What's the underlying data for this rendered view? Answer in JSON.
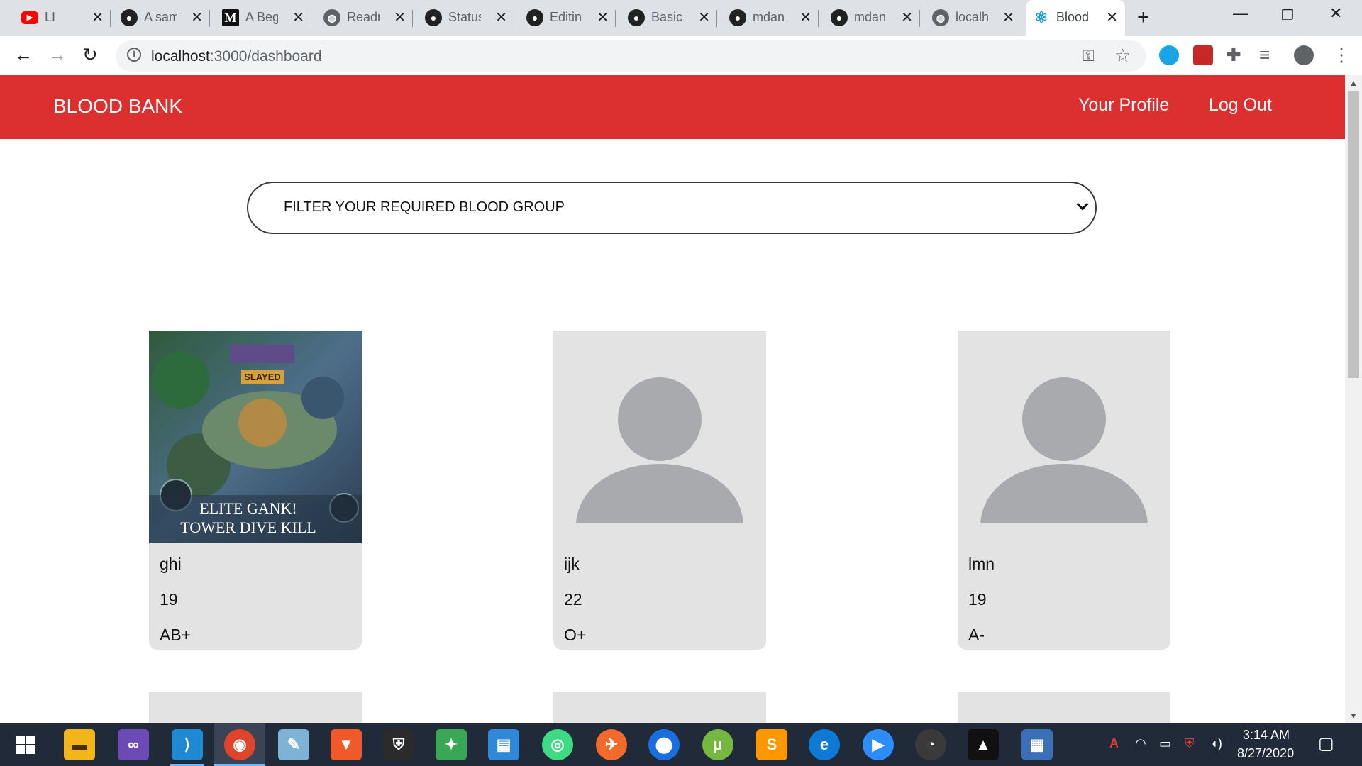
{
  "browser": {
    "tabs": [
      {
        "icon": "youtube-icon",
        "title": "LI"
      },
      {
        "icon": "github-icon",
        "title": "A sam"
      },
      {
        "icon": "medium-icon",
        "title": "A Beg"
      },
      {
        "icon": "globe-icon",
        "title": "Readr"
      },
      {
        "icon": "github-icon",
        "title": "Status"
      },
      {
        "icon": "github-icon",
        "title": "Editin"
      },
      {
        "icon": "github-icon",
        "title": "Basic"
      },
      {
        "icon": "github-icon",
        "title": "mdan"
      },
      {
        "icon": "github-icon",
        "title": "mdan"
      },
      {
        "icon": "globe-icon",
        "title": "localh"
      },
      {
        "icon": "react-icon",
        "title": "Blood",
        "active": true
      }
    ],
    "address": {
      "host": "localhost",
      "path": ":3000/dashboard"
    }
  },
  "app": {
    "brand": "BLOOD BANK",
    "nav": {
      "profile": "Your Profile",
      "logout": "Log Out"
    },
    "filter": {
      "selected": "FILTER YOUR REQUIRED BLOOD GROUP"
    },
    "donors": [
      {
        "name": "ghi",
        "age": "19",
        "blood_group": "AB+",
        "photo": "game-screenshot",
        "photo_caption_1": "ELITE GANK!",
        "photo_caption_2": "TOWER DIVE KILL",
        "photo_banner": "SLAYED"
      },
      {
        "name": "ijk",
        "age": "22",
        "blood_group": "O+",
        "photo": "default-avatar"
      },
      {
        "name": "lmn",
        "age": "19",
        "blood_group": "A-",
        "photo": "default-avatar"
      }
    ]
  },
  "taskbar": {
    "time": "3:14 AM",
    "date": "8/27/2020"
  },
  "colors": {
    "navbar": "#dc3030",
    "card": "#e3e3e3",
    "avatar": "#a8aaad",
    "taskbar": "#202a38"
  }
}
